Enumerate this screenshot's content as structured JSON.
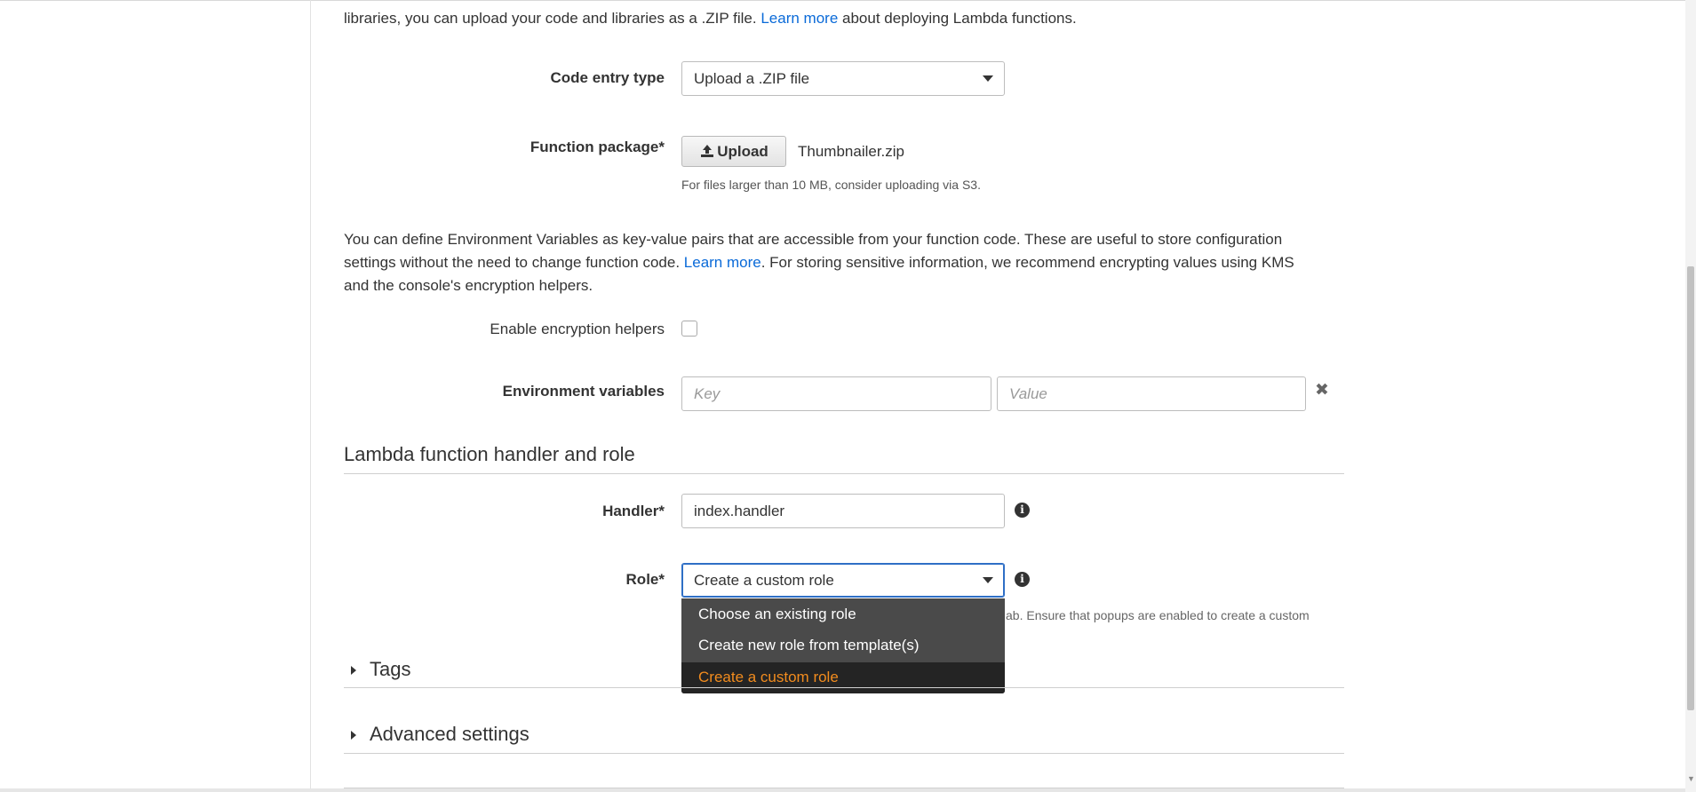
{
  "intro": {
    "line1": "libraries, you can upload your code and libraries as a .ZIP file.",
    "link": "Learn more",
    "line1_end": "about deploying Lambda functions."
  },
  "code_entry": {
    "label": "Code entry type",
    "value": "Upload a .ZIP file"
  },
  "function_package": {
    "label": "Function package*",
    "upload_label": "Upload",
    "file_name": "Thumbnailer.zip",
    "hint": "For files larger than 10 MB, consider uploading via S3."
  },
  "env_intro": {
    "line1": "You can define Environment Variables as key-value pairs that are accessible from your function code. These are useful to store configuration",
    "line2_start": "settings without the need to change function code.",
    "link": "Learn more",
    "line2_end": ". For storing sensitive information, we recommend encrypting values using KMS",
    "line3": "and the console's encryption helpers."
  },
  "encryption": {
    "label": "Enable encryption helpers",
    "checked": false
  },
  "env_vars": {
    "label": "Environment variables",
    "key_placeholder": "Key",
    "value_placeholder": "Value"
  },
  "handler_section": {
    "title": "Lambda function handler and role"
  },
  "handler": {
    "label": "Handler*",
    "value": "index.handler"
  },
  "role": {
    "label": "Role*",
    "value": "Create a custom role",
    "hint_fragment": "ab. Ensure that popups are enabled to create a custom",
    "options": [
      {
        "label": "Choose an existing role"
      },
      {
        "label": "Create new role from template(s)"
      },
      {
        "label": "Create a custom role"
      }
    ],
    "selected_index": 2
  },
  "tags": {
    "label": "Tags"
  },
  "advanced": {
    "label": "Advanced settings"
  },
  "colors": {
    "link": "#0a6ad8",
    "dropdown_bg": "#4a4a4a",
    "selected_text": "#f28c1e",
    "focus_border": "#2f6fc6"
  }
}
